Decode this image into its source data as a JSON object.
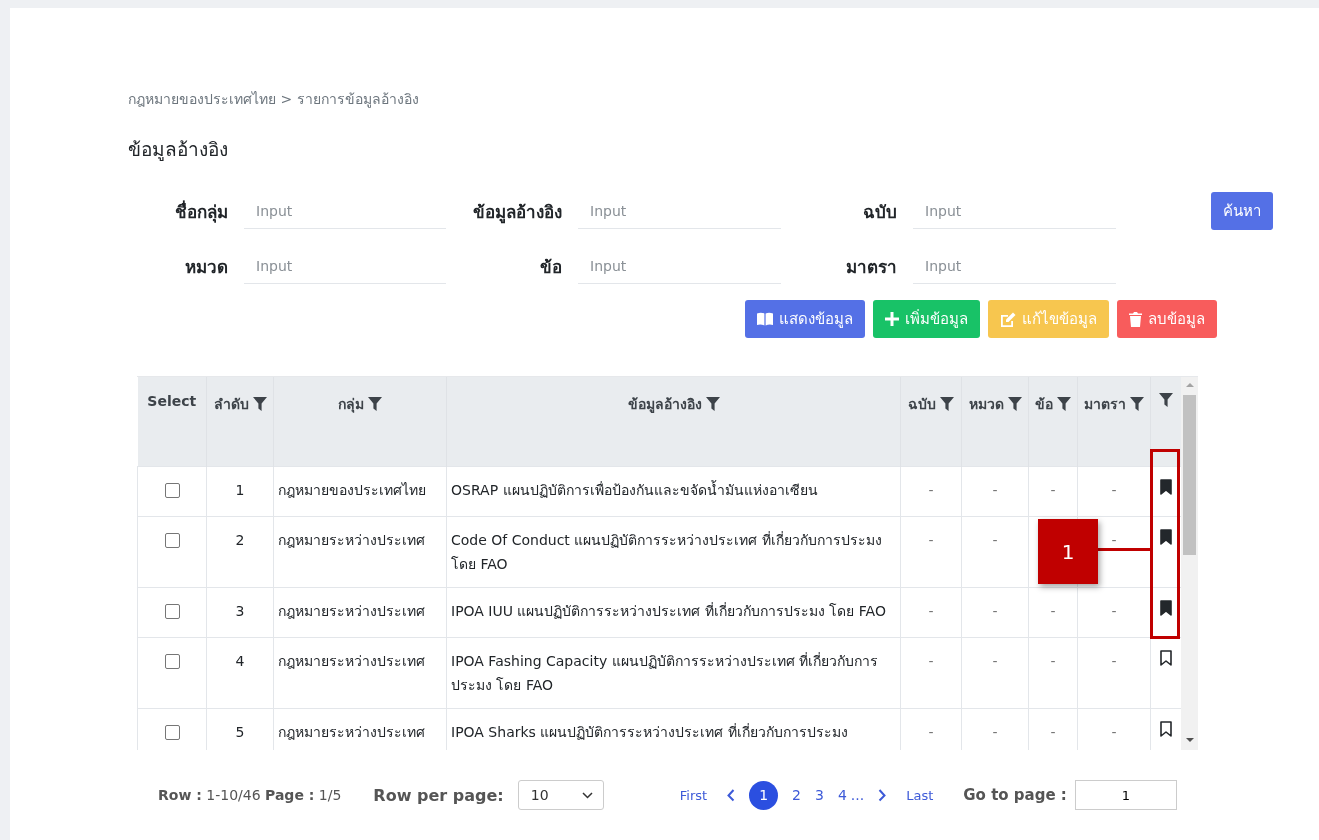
{
  "breadcrumb": "กฎหมายของประเทศไทย > รายการข้อมูลอ้างอิง",
  "title": "ข้อมูลอ้างอิง",
  "filters": [
    {
      "label": "ชื่อกลุ่ม",
      "placeholder": "Input"
    },
    {
      "label": "ข้อมูลอ้างอิง",
      "placeholder": "Input"
    },
    {
      "label": "ฉบับ",
      "placeholder": "Input"
    },
    {
      "label": "หมวด",
      "placeholder": "Input"
    },
    {
      "label": "ข้อ",
      "placeholder": "Input"
    },
    {
      "label": "มาตรา",
      "placeholder": "Input"
    }
  ],
  "search_button": "ค้นหา",
  "actions": [
    {
      "kind": "view",
      "label": "แสดงข้อมูล"
    },
    {
      "kind": "add",
      "label": "เพิ่มข้อมูล"
    },
    {
      "kind": "edit",
      "label": "แก้ไขข้อมูล"
    },
    {
      "kind": "delete",
      "label": "ลบข้อมูล"
    }
  ],
  "table": {
    "columns": [
      {
        "label": "Select",
        "filter": false
      },
      {
        "label": "ลำดับ",
        "filter": true
      },
      {
        "label": "กลุ่ม",
        "filter": true
      },
      {
        "label": "ข้อมูลอ้างอิง",
        "filter": true
      },
      {
        "label": "ฉบับ",
        "filter": true
      },
      {
        "label": "หมวด",
        "filter": true
      },
      {
        "label": "ข้อ",
        "filter": true
      },
      {
        "label": "มาตรา",
        "filter": true
      },
      {
        "filter": true
      }
    ],
    "rows": [
      {
        "checked": false,
        "no": "1",
        "group": "กฎหมายของประเทศไทย",
        "reference": "OSRAP แผนปฏิบัติการเพื่อป้องกันและขจัดน้ำมันแห่งอาเซียน",
        "edition": "-",
        "category": "-",
        "clause": "-",
        "section": "-",
        "bookmarked": true
      },
      {
        "checked": false,
        "no": "2",
        "group": "กฎหมายระหว่างประเทศ",
        "reference": "Code Of Conduct แผนปฏิบัติการระหว่างประเทศ ที่เกี่ยวกับการประมง โดย FAO",
        "edition": "-",
        "category": "-",
        "section": "-",
        "bookmarked": true
      },
      {
        "checked": false,
        "no": "3",
        "group": "กฎหมายระหว่างประเทศ",
        "reference": "IPOA IUU  แผนปฏิบัติการระหว่างประเทศ ที่เกี่ยวกับการประมง โดย FAO",
        "edition": "-",
        "category": "-",
        "clause": "-",
        "section": "-",
        "bookmarked": true
      },
      {
        "checked": false,
        "no": "4",
        "group": "กฎหมายระหว่างประเทศ",
        "reference": "IPOA Fashing Capacity แผนปฏิบัติการระหว่างประเทศ ที่เกี่ยวกับการประมง โดย FAO",
        "edition": "-",
        "category": "-",
        "clause": "-",
        "section": "-",
        "bookmarked": false
      },
      {
        "checked": false,
        "no": "5",
        "group": "กฎหมายระหว่างประเทศ",
        "reference": "IPOA Sharks แผนปฏิบัติการระหว่างประเทศ ที่เกี่ยวกับการประมง",
        "edition": "-",
        "category": "-",
        "clause": "-",
        "section": "-",
        "bookmarked": false
      }
    ]
  },
  "callout": {
    "label": "1"
  },
  "pagination": {
    "summary": "**Row :** 1-10/46 **Page :** 1/5",
    "rows_label": "Row per page:",
    "rows_value": "10",
    "first": "First",
    "pages": [
      {
        "label": "1",
        "selected": true
      },
      {
        "label": "2",
        "selected": false
      },
      {
        "label": "3",
        "selected": false
      },
      {
        "label": "4",
        "selected": false
      }
    ],
    "ellipsis": "...",
    "last": "Last",
    "goto_label": "Go to page :",
    "goto_value": "1"
  }
}
